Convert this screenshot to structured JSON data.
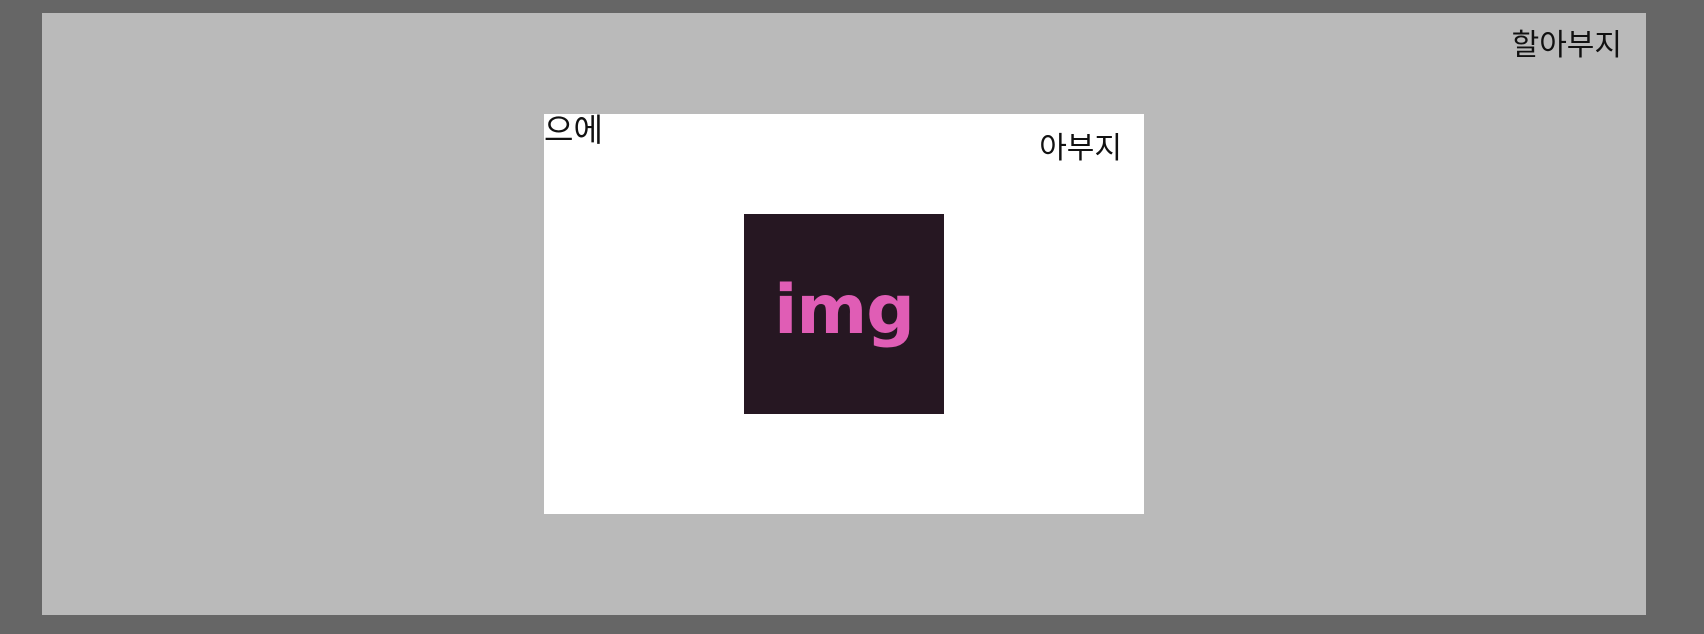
{
  "labels": {
    "grandparent": "할아부지",
    "parent": "아부지",
    "corner": "으에"
  },
  "image_placeholder": {
    "text": "img",
    "background_color": "#261722",
    "text_color": "#e05db5"
  },
  "colors": {
    "page_background": "#666666",
    "outer_frame": "#bababa",
    "inner_panel": "#ffffff"
  }
}
